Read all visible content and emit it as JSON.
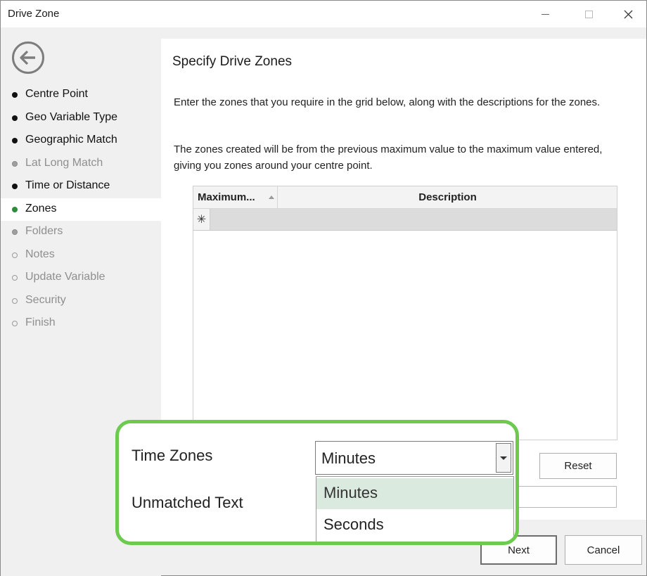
{
  "window": {
    "title": "Drive Zone"
  },
  "sidebar": {
    "items": [
      {
        "label": "Centre Point",
        "state": "done"
      },
      {
        "label": "Geo Variable Type",
        "state": "done"
      },
      {
        "label": "Geographic Match",
        "state": "done"
      },
      {
        "label": "Lat Long Match",
        "state": "skipped"
      },
      {
        "label": "Time or Distance",
        "state": "done"
      },
      {
        "label": "Zones",
        "state": "current"
      },
      {
        "label": "Folders",
        "state": "skipped"
      },
      {
        "label": "Notes",
        "state": "future"
      },
      {
        "label": "Update Variable",
        "state": "future"
      },
      {
        "label": "Security",
        "state": "future"
      },
      {
        "label": "Finish",
        "state": "future"
      }
    ]
  },
  "main": {
    "heading": "Specify Drive Zones",
    "paragraph1": "Enter the zones that you require in the grid below, along with the descriptions for the zones.",
    "paragraph2": "The zones created will be from the previous maximum value to the maximum value entered, giving you zones around your centre point.",
    "grid": {
      "columns": [
        "Maximum...",
        "Description"
      ],
      "new_row_marker": "✳"
    },
    "reset_label": "Reset"
  },
  "callout": {
    "time_zones_label": "Time Zones",
    "unmatched_label": "Unmatched Text",
    "combo_value": "Minutes",
    "options": [
      "Minutes",
      "Seconds"
    ]
  },
  "footer": {
    "next_label": "Next",
    "cancel_label": "Cancel"
  },
  "colors": {
    "current_bullet": "#2e8b3a",
    "callout_border": "#6ccb4e",
    "hover_option": "#dbeadf"
  }
}
